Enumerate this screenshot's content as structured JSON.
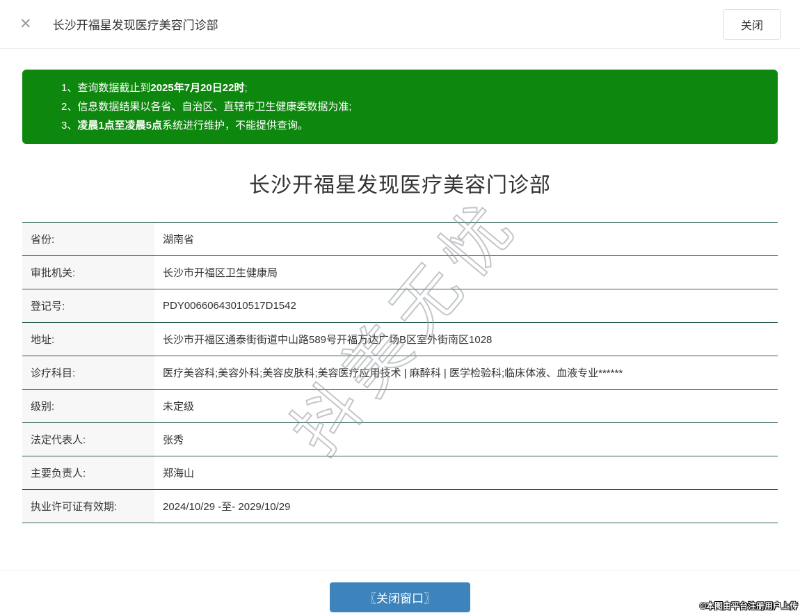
{
  "header": {
    "close_icon": "✕",
    "title": "长沙开福星发现医疗美容门诊部",
    "close_button_label": "关闭"
  },
  "notice": {
    "background_color": "#0e870e",
    "items": [
      {
        "num": "1、",
        "pre": "查询数据截止到",
        "bold": "2025年7月20日22时",
        "post": ";"
      },
      {
        "num": "2、",
        "pre": "信息数据结果以各省、自治区、直辖市卫生健康委数据为准;",
        "bold": "",
        "post": ""
      },
      {
        "num": "3、",
        "pre": "",
        "bold": "凌晨1点至凌晨5点",
        "post": "系统进行维护，不能提供查询。"
      }
    ]
  },
  "main": {
    "title": "长沙开福星发现医疗美容门诊部",
    "table": {
      "rows": [
        {
          "label": "省份:",
          "value": "湖南省"
        },
        {
          "label": "审批机关:",
          "value": "长沙市开福区卫生健康局"
        },
        {
          "label": "登记号:",
          "value": "PDY00660643010517D1542"
        },
        {
          "label": "地址:",
          "value": "长沙市开福区通泰街街道中山路589号开福万达广场B区室外街南区1028"
        },
        {
          "label": "诊疗科目:",
          "value": "医疗美容科;美容外科;美容皮肤科;美容医疗应用技术 | 麻醉科 | 医学检验科;临床体液、血液专业******"
        },
        {
          "label": "级别:",
          "value": "未定级"
        },
        {
          "label": "法定代表人:",
          "value": "张秀"
        },
        {
          "label": "主要负责人:",
          "value": "郑海山"
        },
        {
          "label": "执业许可证有效期:",
          "value": "2024/10/29 -至- 2029/10/29"
        }
      ]
    }
  },
  "footer": {
    "close_window_button": "〖关闭窗口〗",
    "button_color": "#3e84bc"
  },
  "watermark": {
    "text": "抖美无忧"
  },
  "copyright": "©本图由平台注册用户上传"
}
